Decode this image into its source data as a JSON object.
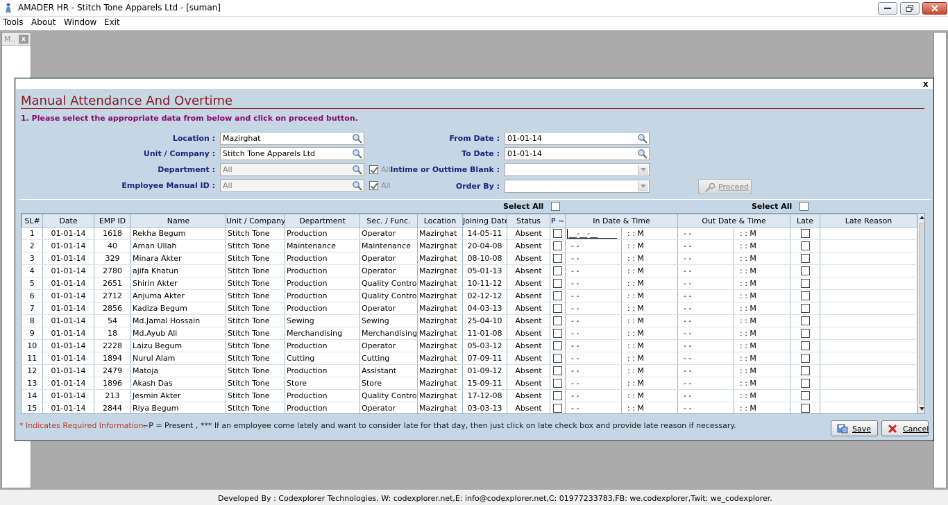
{
  "window": {
    "title": "AMADER HR - Stitch Tone Apparels Ltd - [suman]"
  },
  "menu": [
    "Tools",
    "About",
    "Window",
    "Exit"
  ],
  "mdi_child": {
    "title": "M..",
    "close": "x"
  },
  "form": {
    "title": "Manual Attendance And Overtime",
    "instruction": "1. Please select the appropriate data from below and click on proceed button.",
    "close": "x",
    "fields": {
      "location_label": "Location :",
      "location_value": "Mazirghat",
      "unit_label": "Unit / Company :",
      "unit_value": "Stitch Tone Apparels Ltd",
      "department_label": "Department :",
      "department_value": "All",
      "department_all": "All",
      "employee_label": "Employee Manual ID :",
      "employee_value": "All",
      "employee_all": "All",
      "from_date_label": "From Date :",
      "from_date_value": "01-01-14",
      "to_date_label": "To Date :",
      "to_date_value": "01-01-14",
      "intime_label": "Intime or Outtime Blank :",
      "intime_value": "",
      "order_by_label": "Order By :",
      "order_by_value": ""
    },
    "proceed_label": "Proceed",
    "select_all_1": "Select All",
    "select_all_2": "Select All"
  },
  "grid": {
    "headers": [
      "SL#",
      "Date",
      "EMP ID",
      "Name",
      "Unit / Company",
      "Department",
      "Sec. / Func.",
      "Location",
      "Joining Date",
      "Status",
      "P ~",
      "In Date & Time",
      "Out Date & Time",
      "Late",
      "Late Reason"
    ],
    "in_edit_placeholder": "__-__-__",
    "date_blank": "- -",
    "time_blank": ": :   M",
    "rows": [
      {
        "sl": "1",
        "date": "01-01-14",
        "emp": "1618",
        "name": "Rekha Begum",
        "unit": "Stitch Tone",
        "dept": "Production",
        "sec": "Operator",
        "loc": "Mazirghat",
        "join": "14-05-11",
        "status": "Absent"
      },
      {
        "sl": "2",
        "date": "01-01-14",
        "emp": "40",
        "name": "Aman Ullah",
        "unit": "Stitch Tone",
        "dept": "Maintenance",
        "sec": "Maintenance",
        "loc": "Mazirghat",
        "join": "20-04-08",
        "status": "Absent"
      },
      {
        "sl": "3",
        "date": "01-01-14",
        "emp": "329",
        "name": "Minara Akter",
        "unit": "Stitch Tone",
        "dept": "Production",
        "sec": "Operator",
        "loc": "Mazirghat",
        "join": "08-10-08",
        "status": "Absent"
      },
      {
        "sl": "4",
        "date": "01-01-14",
        "emp": "2780",
        "name": "ajifa Khatun",
        "unit": "Stitch Tone",
        "dept": "Production",
        "sec": "Operator",
        "loc": "Mazirghat",
        "join": "05-01-13",
        "status": "Absent"
      },
      {
        "sl": "5",
        "date": "01-01-14",
        "emp": "2651",
        "name": "Shirin Akter",
        "unit": "Stitch Tone",
        "dept": "Production",
        "sec": "Quality Control",
        "loc": "Mazirghat",
        "join": "10-11-12",
        "status": "Absent"
      },
      {
        "sl": "6",
        "date": "01-01-14",
        "emp": "2712",
        "name": "Anjuma Akter",
        "unit": "Stitch Tone",
        "dept": "Production",
        "sec": "Quality Control",
        "loc": "Mazirghat",
        "join": "02-12-12",
        "status": "Absent"
      },
      {
        "sl": "7",
        "date": "01-01-14",
        "emp": "2856",
        "name": "Kadiza Begum",
        "unit": "Stitch Tone",
        "dept": "Production",
        "sec": "Operator",
        "loc": "Mazirghat",
        "join": "04-03-13",
        "status": "Absent"
      },
      {
        "sl": "8",
        "date": "01-01-14",
        "emp": "54",
        "name": "Md.Jamal Hossain",
        "unit": "Stitch Tone",
        "dept": "Sewing",
        "sec": "Sewing",
        "loc": "Mazirghat",
        "join": "25-04-10",
        "status": "Absent"
      },
      {
        "sl": "9",
        "date": "01-01-14",
        "emp": "18",
        "name": "Md.Ayub Ali",
        "unit": "Stitch Tone",
        "dept": "Merchandising",
        "sec": "Merchandising",
        "loc": "Mazirghat",
        "join": "11-01-08",
        "status": "Absent"
      },
      {
        "sl": "10",
        "date": "01-01-14",
        "emp": "2228",
        "name": "Laizu Begum",
        "unit": "Stitch Tone",
        "dept": "Production",
        "sec": "Operator",
        "loc": "Mazirghat",
        "join": "05-03-12",
        "status": "Absent"
      },
      {
        "sl": "11",
        "date": "01-01-14",
        "emp": "1894",
        "name": "Nurul Alam",
        "unit": "Stitch Tone",
        "dept": "Cutting",
        "sec": "Cutting",
        "loc": "Mazirghat",
        "join": "07-09-11",
        "status": "Absent"
      },
      {
        "sl": "12",
        "date": "01-01-14",
        "emp": "2479",
        "name": "Matoja",
        "unit": "Stitch Tone",
        "dept": "Production",
        "sec": "Assistant",
        "loc": "Mazirghat",
        "join": "01-09-12",
        "status": "Absent"
      },
      {
        "sl": "13",
        "date": "01-01-14",
        "emp": "1896",
        "name": "Akash Das",
        "unit": "Stitch Tone",
        "dept": "Store",
        "sec": "Store",
        "loc": "Mazirghat",
        "join": "15-09-11",
        "status": "Absent"
      },
      {
        "sl": "14",
        "date": "01-01-14",
        "emp": "213",
        "name": "Jesmin  Akter",
        "unit": "Stitch Tone",
        "dept": "Production",
        "sec": "Quality Control",
        "loc": "Mazirghat",
        "join": "17-12-08",
        "status": "Absent"
      },
      {
        "sl": "15",
        "date": "01-01-14",
        "emp": "2844",
        "name": "Riya Begum",
        "unit": "Stitch Tone",
        "dept": "Production",
        "sec": "Operator",
        "loc": "Mazirghat",
        "join": "03-03-13",
        "status": "Absent"
      }
    ]
  },
  "notes": {
    "required": "* Indicates Required Information.",
    "legend": "~P = Present ,  *** If an employee come lately and want to consider late for that day, then just click on late check box and provide late reason if necessary."
  },
  "buttons": {
    "save": "Save",
    "cancel": "Cancel"
  },
  "footer": "Developed By : Codexplorer Technologies. W: codexplorer.net,E: info@codexplorer.net,C: 01977233783,FB: we.codexplorer,Twit: we_codexplorer."
}
